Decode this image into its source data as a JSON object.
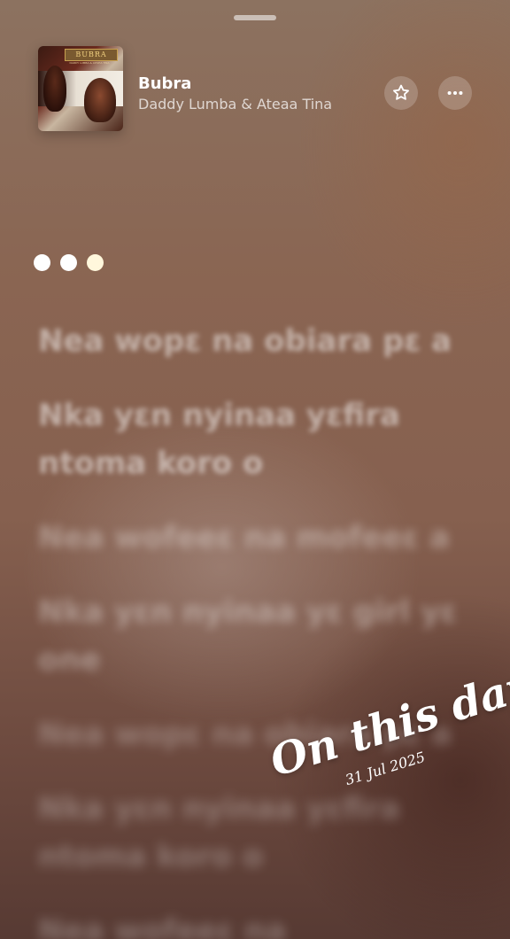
{
  "now_playing": {
    "title": "Bubra",
    "artist": "Daddy Lumba & Ateaa Tina",
    "artwork": {
      "title": "BUBRA",
      "credit": "DADDY LUMBA & AYISHA TINA"
    }
  },
  "icons": {
    "favorite": "star-icon",
    "more": "more-icon",
    "grabber": "grabber-handle"
  },
  "lyrics": [
    "Nea wopɛ na obiara pɛ a",
    "Nka yɛn nyinaa yɛfira ntoma koro o",
    "Nea wofeeɛ na mofeeɛ a",
    "Nka yɛn nyinaa yɛ girl yɛ one",
    "Nea wopɛ na obiara pɛ a",
    "Nka yɛn nyinaa yɛfira ntoma koro o",
    "Nea wofeeɛ na"
  ],
  "overlay": {
    "headline": "On this day",
    "date": "31 Jul 2025"
  },
  "colors": {
    "background_top": "#8c7260",
    "background_bottom": "#573a33",
    "text_primary": "#ffffff"
  }
}
